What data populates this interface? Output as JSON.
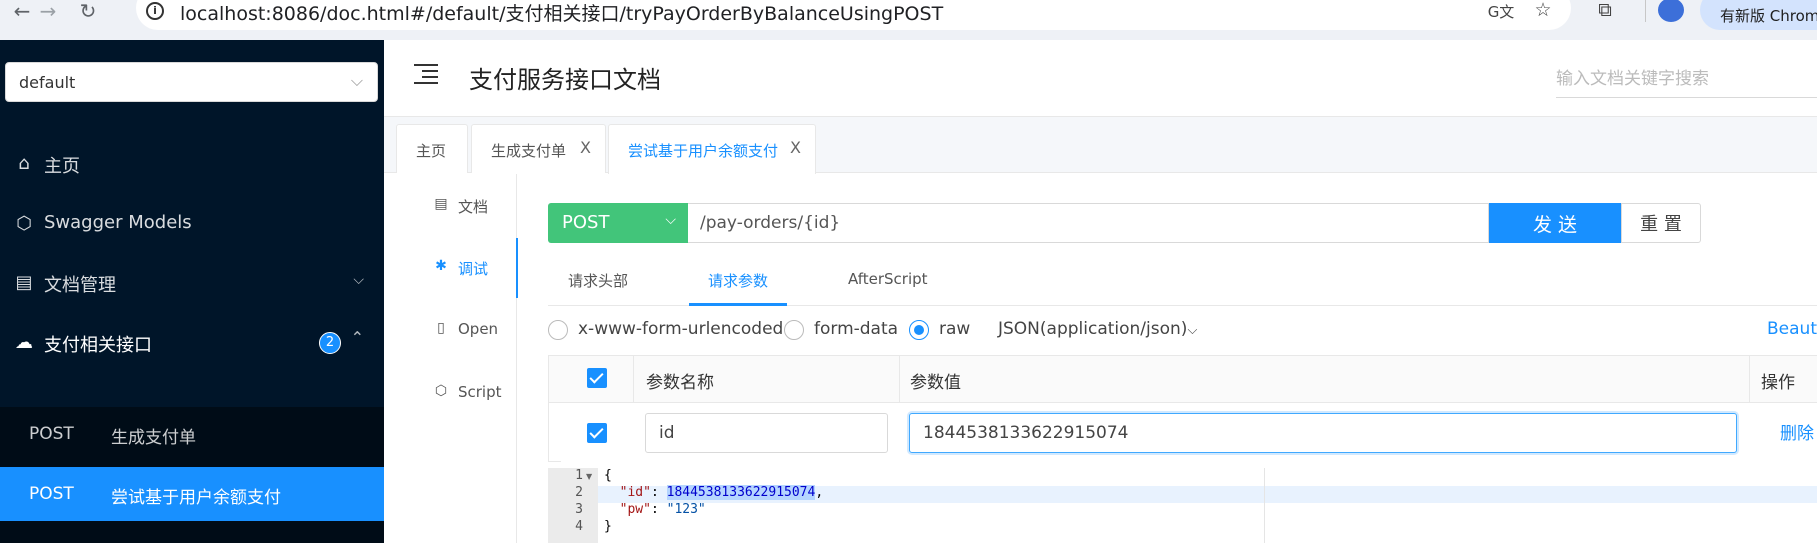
{
  "browser": {
    "url": "localhost:8086/doc.html#/default/支付相关接口/tryPayOrderByBalanceUsingPOST",
    "update_label": "有新版 Chrom"
  },
  "sidebar": {
    "group_select": "default",
    "items": [
      {
        "label": "主页",
        "icon": "home-icon"
      },
      {
        "label": "Swagger Models",
        "icon": "cube-icon"
      },
      {
        "label": "文档管理",
        "icon": "doc-manage-icon"
      },
      {
        "label": "支付相关接口",
        "icon": "cloud-icon",
        "badge": "2"
      }
    ],
    "sub_items": [
      {
        "method": "POST",
        "name": "生成支付单"
      },
      {
        "method": "POST",
        "name": "尝试基于用户余额支付"
      }
    ]
  },
  "header": {
    "title": "支付服务接口文档",
    "search_placeholder": "输入文档关键字搜索"
  },
  "tabs": [
    {
      "label": "主页"
    },
    {
      "label": "生成支付单",
      "close": "X"
    },
    {
      "label": "尝试基于用户余额支付",
      "close": "X"
    }
  ],
  "vtabs": [
    {
      "label": "文档"
    },
    {
      "label": "调试"
    },
    {
      "label": "Open"
    },
    {
      "label": "Script"
    }
  ],
  "request": {
    "method": "POST",
    "url": "/pay-orders/{id}",
    "send_label": "发 送",
    "reset_label": "重 置"
  },
  "subtabs": [
    "请求头部",
    "请求参数",
    "AfterScript"
  ],
  "body_types": {
    "urlencoded": "x-www-form-urlencoded",
    "form_data": "form-data",
    "raw": "raw",
    "content_type": "JSON(application/json)",
    "beautify": "Beauti"
  },
  "param_table": {
    "col_name": "参数名称",
    "col_value": "参数值",
    "col_action": "操作",
    "row": {
      "name": "id",
      "value": "1844538133622915074",
      "delete": "删除"
    }
  },
  "editor": {
    "line_numbers": [
      "1",
      "2",
      "3",
      "4"
    ],
    "open_brace": "{",
    "close_brace": "}",
    "id_key": "\"id\"",
    "id_value": "1844538133622915074",
    "pw_key": "\"pw\"",
    "pw_value": "\"123\""
  },
  "colors": {
    "sidebar_bg": "#001529",
    "accent": "#1890ff",
    "post_method": "#42c57a"
  }
}
